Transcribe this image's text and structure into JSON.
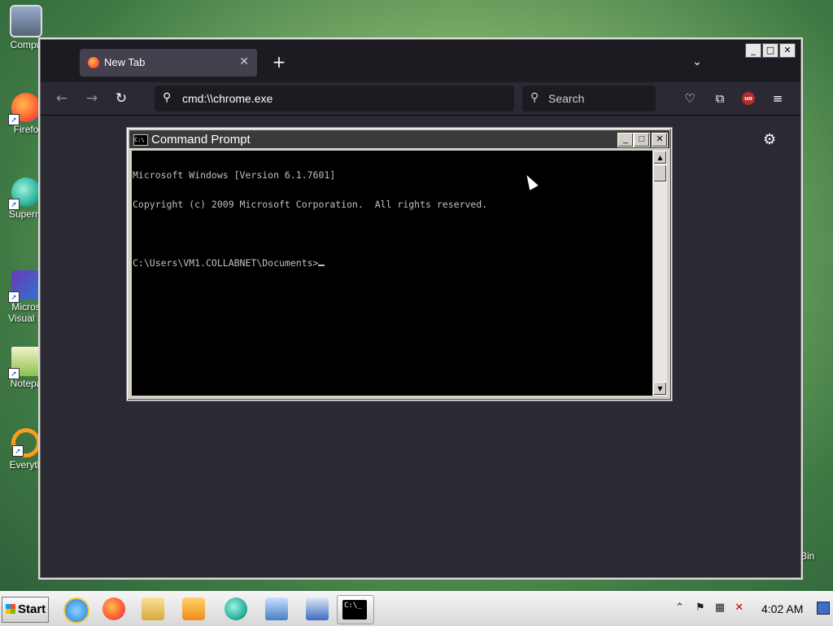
{
  "desktop": {
    "icons": [
      {
        "label": "Compu"
      },
      {
        "label": "Firefo"
      },
      {
        "label": "Superm"
      },
      {
        "label": "Micros"
      },
      {
        "label": "Visual S"
      },
      {
        "label": "Notepa"
      },
      {
        "label": "Everyth"
      }
    ],
    "recycle_label": "Bin"
  },
  "firefox": {
    "tab_title": "New Tab",
    "url": "cmd:\\\\chrome.exe",
    "search_placeholder": "Search",
    "ublock_badge": "uo",
    "window_controls": {
      "minimize": "_",
      "maximize": "□",
      "close": "✕"
    }
  },
  "cmd": {
    "title": "Command Prompt",
    "icon_text": "C:\\",
    "lines": [
      "Microsoft Windows [Version 6.1.7601]",
      "Copyright (c) 2009 Microsoft Corporation.  All rights reserved.",
      "",
      "C:\\Users\\VM1.COLLABNET\\Documents>"
    ]
  },
  "taskbar": {
    "start_label": "Start",
    "clock": "4:02 AM",
    "cmd_icon_text": "C:\\_"
  },
  "colors": {
    "ff_dark": "#1c1b22",
    "ff_toolbar": "#2b2a33",
    "cmd_bg": "#000000",
    "cmd_text": "#c0c0c0"
  }
}
